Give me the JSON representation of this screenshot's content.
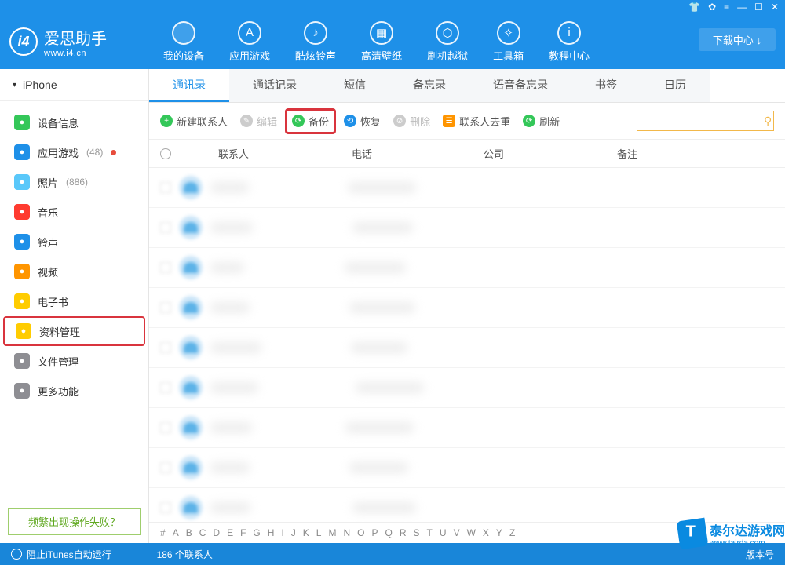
{
  "titlebar": {
    "icons": [
      "shirt",
      "gear",
      "skin",
      "min",
      "max",
      "close"
    ]
  },
  "logo": {
    "title": "爱思助手",
    "url": "www.i4.cn"
  },
  "topnav": [
    {
      "label": "我的设备",
      "active": true
    },
    {
      "label": "应用游戏"
    },
    {
      "label": "酷炫铃声"
    },
    {
      "label": "高清壁纸"
    },
    {
      "label": "刷机越狱"
    },
    {
      "label": "工具箱"
    },
    {
      "label": "教程中心"
    }
  ],
  "download_center": "下载中心 ↓",
  "device": "iPhone",
  "sidebar": [
    {
      "icon": "#34c759",
      "label": "设备信息"
    },
    {
      "icon": "#1e90e8",
      "label": "应用游戏",
      "count": "(48)",
      "dot": true
    },
    {
      "icon": "#5ac8fa",
      "label": "照片",
      "count": "(886)"
    },
    {
      "icon": "#ff3b30",
      "label": "音乐"
    },
    {
      "icon": "#1e90e8",
      "label": "铃声"
    },
    {
      "icon": "#ff9500",
      "label": "视频"
    },
    {
      "icon": "#ffcc00",
      "label": "电子书"
    },
    {
      "icon": "#ffcc00",
      "label": "资料管理",
      "highlighted": true
    },
    {
      "icon": "#8e8e93",
      "label": "文件管理"
    },
    {
      "icon": "#8e8e93",
      "label": "更多功能"
    }
  ],
  "help_link": "频繁出现操作失败？",
  "tabs": [
    {
      "label": "通讯录",
      "active": true
    },
    {
      "label": "通话记录"
    },
    {
      "label": "短信"
    },
    {
      "label": "备忘录"
    },
    {
      "label": "语音备忘录"
    },
    {
      "label": "书签"
    },
    {
      "label": "日历"
    }
  ],
  "toolbar": {
    "new": "新建联系人",
    "edit": "编辑",
    "backup": "备份",
    "restore": "恢复",
    "delete": "删除",
    "dedup": "联系人去重",
    "refresh": "刷新"
  },
  "columns": {
    "contact": "联系人",
    "phone": "电话",
    "company": "公司",
    "note": "备注"
  },
  "row_count": 9,
  "alpha": [
    "#",
    "A",
    "B",
    "C",
    "D",
    "E",
    "F",
    "G",
    "H",
    "I",
    "J",
    "K",
    "L",
    "M",
    "N",
    "O",
    "P",
    "Q",
    "R",
    "S",
    "T",
    "U",
    "V",
    "W",
    "X",
    "Y",
    "Z"
  ],
  "status": {
    "left": "阻止iTunes自动运行",
    "center": "186 个联系人",
    "right": "版本号"
  },
  "watermark": {
    "text": "泰尔达游戏网",
    "sub": "www.tairda.com"
  }
}
